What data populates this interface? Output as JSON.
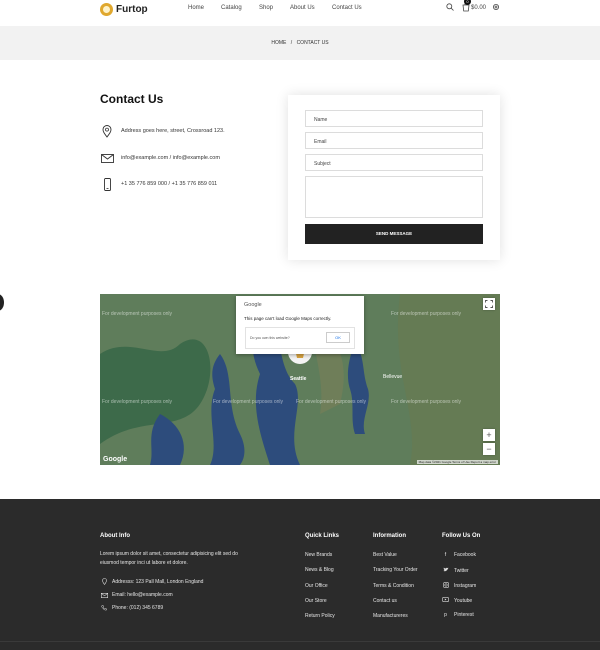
{
  "header": {
    "brand": "Furtop",
    "nav": [
      "Home",
      "Catalog",
      "Shop",
      "About Us",
      "Contact Us"
    ],
    "cart_count": "0",
    "cart_total": "$0.00"
  },
  "breadcrumb": {
    "home": "HOME",
    "sep": "/",
    "current": "CONTACT US"
  },
  "contact": {
    "title": "Contact Us",
    "address": "Address goes here, street, Crossroad 123.",
    "email": "info@example.com / info@example.com",
    "phone": "+1 35 776 859 000 / +1 35 776 859 011"
  },
  "form": {
    "name_placeholder": "Name",
    "email_placeholder": "Email",
    "subject_placeholder": "Subject",
    "message_placeholder": "",
    "send_label": "SEND MESSAGE"
  },
  "map": {
    "watermark": "For development purposes only",
    "city_label": "Seattle",
    "bellevue_label": "Bellevue",
    "dialog_brand": "Google",
    "dialog_message": "This page can't load Google Maps correctly.",
    "dialog_question": "Do you own this website?",
    "dialog_ok": "OK",
    "google_logo": "Google",
    "footer_text": "Map data ©2021 Google   Terms of Use   Report a map error",
    "colors": {
      "land": "#5d7a5e",
      "water": "#2f4f7f"
    }
  },
  "footer": {
    "about_title": "About Info",
    "about_text": "Lorem ipsum dolor sit amet, consectetur adipisicing elit sed do eiusmod tempor inci ut labore et dolore.",
    "address": "Addresss: 123 Pall Mall, London England",
    "email": "Email: hello@example.com",
    "phone": "Phone: (012) 345 6789",
    "quick_title": "Quick Links",
    "quick_links": [
      "New Brands",
      "News & Blog",
      "Our Office",
      "Our Store",
      "Return Policy"
    ],
    "info_title": "Information",
    "info_links": [
      "Best Value",
      "Tracking Your Order",
      "Terms & Condition",
      "Contact us",
      "Manufactureres"
    ],
    "follow_title": "Follow Us On",
    "social": [
      "Facebook",
      "Twitter",
      "Instagram",
      "Youtube",
      "Pinterest"
    ]
  }
}
